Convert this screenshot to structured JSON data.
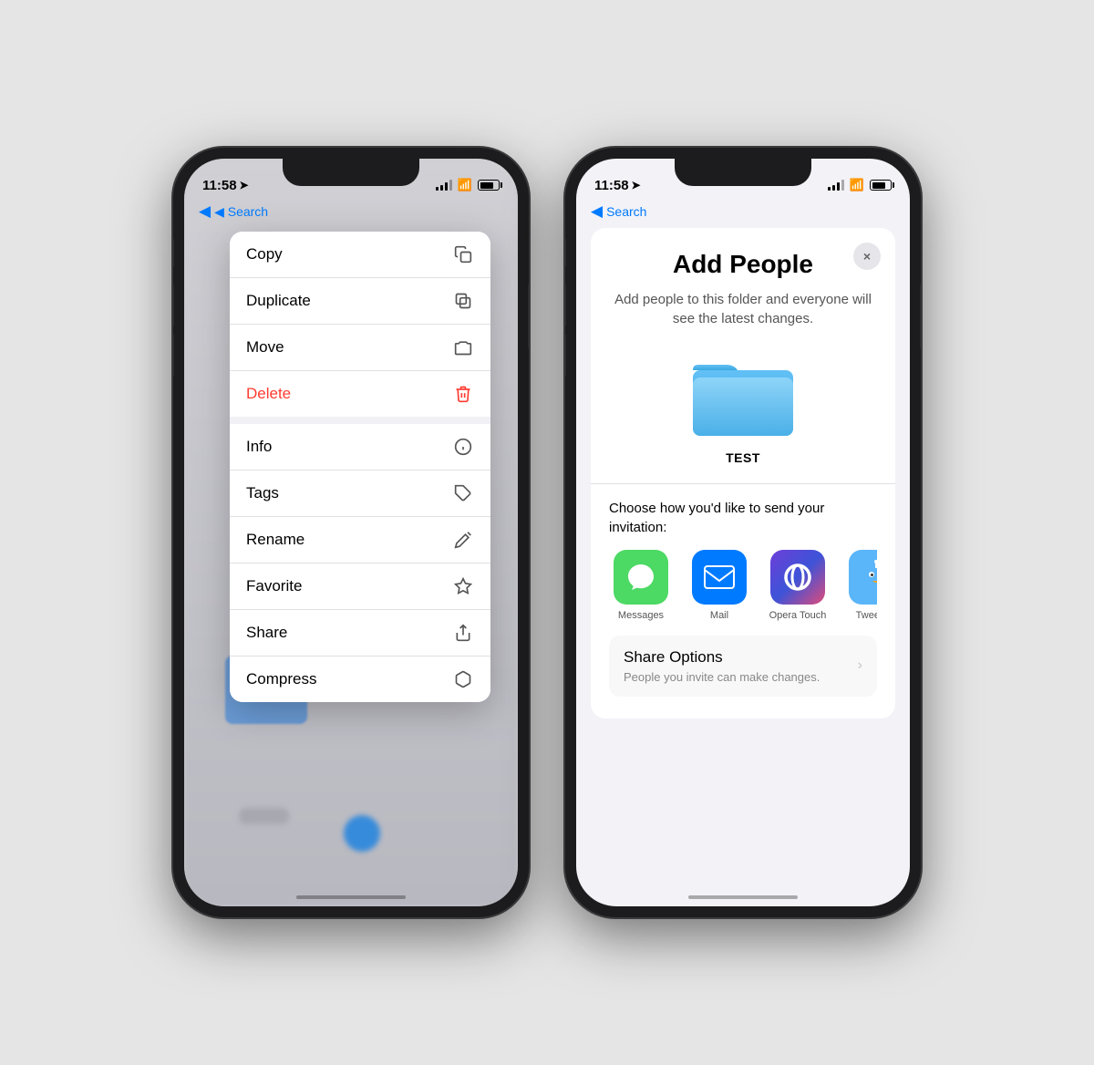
{
  "phone1": {
    "status": {
      "time": "11:58",
      "location_icon": "▶",
      "back_label": "◀ Search"
    },
    "menu_items": [
      {
        "label": "Copy",
        "icon": "copy",
        "color": "normal"
      },
      {
        "label": "Duplicate",
        "icon": "duplicate",
        "color": "normal"
      },
      {
        "label": "Move",
        "icon": "folder",
        "color": "normal"
      },
      {
        "label": "Delete",
        "icon": "trash",
        "color": "delete"
      },
      {
        "label": "Info",
        "icon": "info",
        "color": "normal"
      },
      {
        "label": "Tags",
        "icon": "tag",
        "color": "normal"
      },
      {
        "label": "Rename",
        "icon": "pencil",
        "color": "normal"
      },
      {
        "label": "Favorite",
        "icon": "star",
        "color": "normal"
      },
      {
        "label": "Share",
        "icon": "share",
        "color": "normal"
      },
      {
        "label": "Compress",
        "icon": "compress",
        "color": "normal"
      }
    ]
  },
  "phone2": {
    "status": {
      "time": "11:58",
      "location_icon": "▶",
      "back_label": "◀ Search"
    },
    "modal": {
      "title": "Add People",
      "subtitle": "Add people to this folder and everyone will see the latest changes.",
      "folder_name": "TEST",
      "invitation_label": "Choose how you'd like to send your invitation:",
      "apps": [
        {
          "name": "Messages",
          "type": "messages"
        },
        {
          "name": "Mail",
          "type": "mail"
        },
        {
          "name": "Opera Touch",
          "type": "opera"
        },
        {
          "name": "Tweetbot",
          "type": "tweetbot"
        }
      ],
      "share_options_title": "Share Options",
      "share_options_subtitle": "People you invite can make changes.",
      "close_button": "×"
    }
  }
}
